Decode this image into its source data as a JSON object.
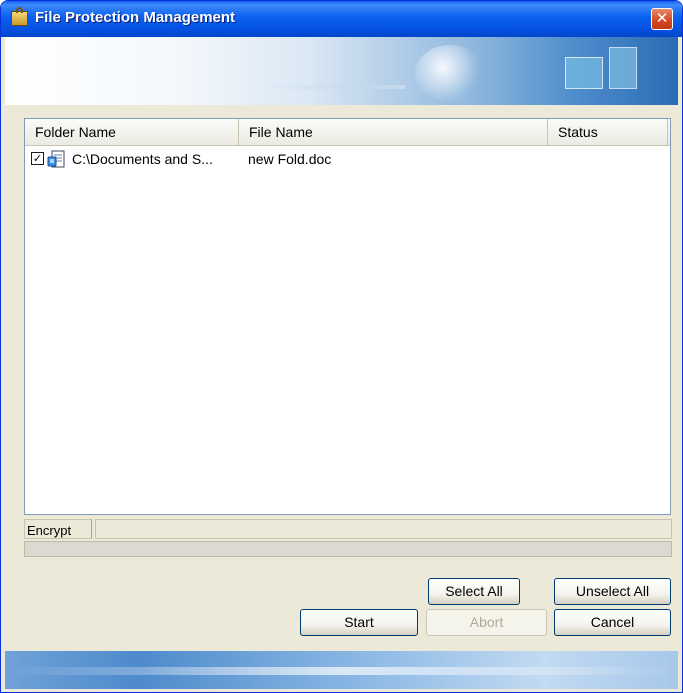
{
  "window": {
    "title": "File Protection Management",
    "close_glyph": "✕"
  },
  "list": {
    "columns": [
      "Folder Name",
      "File Name",
      "Status"
    ],
    "rows": [
      {
        "checked": true,
        "checkbox_glyph": "✓",
        "folder": "C:\\Documents and S...",
        "file": "new Fold.doc",
        "status": ""
      }
    ]
  },
  "status": {
    "operation_label": "Encrypt",
    "progress_value": 0
  },
  "buttons": {
    "select_all": "Select All",
    "unselect_all": "Unselect All",
    "start": "Start",
    "abort": "Abort",
    "cancel": "Cancel"
  },
  "icons": {
    "app": "lock-folder-icon",
    "close": "close-icon",
    "file": "document-icon"
  },
  "colors": {
    "title_bar": "#0a5ef5",
    "close_button": "#d2471f",
    "window_bg": "#ece9d8"
  }
}
